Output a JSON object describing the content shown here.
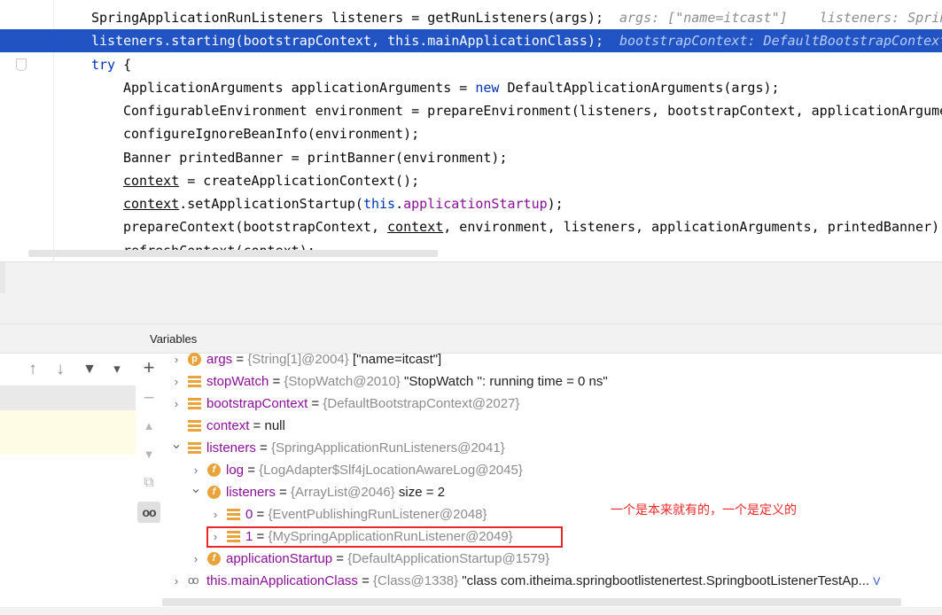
{
  "editor": {
    "lines": [
      {
        "id": "l1",
        "segments": [
          {
            "t": "SpringApplicationRunListeners listeners = getRunListeners(args);"
          }
        ],
        "hint": "args: [\"name=itcast\"]    listeners: Sprin"
      },
      {
        "id": "l2",
        "segments": [
          {
            "t": "listeners.starting(bootstrapContext, this.mainApplicationClass);"
          }
        ],
        "hint": "bootstrapContext: DefaultBootstrapContext@"
      },
      {
        "id": "l3",
        "segments": [
          {
            "t": "try",
            "cls": "kw"
          },
          {
            "t": " {"
          }
        ]
      },
      {
        "id": "l4",
        "segments": [
          {
            "t": "ApplicationArguments applicationArguments = "
          },
          {
            "t": "new",
            "cls": "kw"
          },
          {
            "t": " DefaultApplicationArguments(args);"
          }
        ]
      },
      {
        "id": "l5",
        "segments": [
          {
            "t": "ConfigurableEnvironment environment = prepareEnvironment(listeners, bootstrapContext, applicationArgume"
          }
        ]
      },
      {
        "id": "l6",
        "segments": [
          {
            "t": "configureIgnoreBeanInfo(environment);"
          }
        ]
      },
      {
        "id": "l7",
        "segments": [
          {
            "t": "Banner printedBanner = printBanner(environment);"
          }
        ]
      },
      {
        "id": "l8",
        "segments": [
          {
            "t": "context",
            "cls": "ul"
          },
          {
            "t": " = createApplicationContext();"
          }
        ]
      },
      {
        "id": "l9",
        "segments": [
          {
            "t": "context",
            "cls": "ul"
          },
          {
            "t": ".setApplicationStartup("
          },
          {
            "t": "this",
            "cls": "kw"
          },
          {
            "t": "."
          },
          {
            "t": "applicationStartup",
            "cls": "fld"
          },
          {
            "t": ");"
          }
        ]
      },
      {
        "id": "l10",
        "segments": [
          {
            "t": "prepareContext(bootstrapContext, "
          },
          {
            "t": "context",
            "cls": "ul"
          },
          {
            "t": ", environment, listeners, applicationArguments, printedBanner);"
          }
        ]
      },
      {
        "id": "l11",
        "segments": [
          {
            "t": "refreshContext("
          },
          {
            "t": "context",
            "cls": "ul"
          },
          {
            "t": ");"
          }
        ]
      }
    ]
  },
  "variables": {
    "title": "Variables",
    "rows": [
      {
        "id": "v1",
        "chev": "›",
        "icon": "p",
        "name": "args",
        "ref": "{String[1]@2004}",
        "value": " [\"name=itcast\"]"
      },
      {
        "id": "v2",
        "chev": "›",
        "icon": "list",
        "name": "stopWatch",
        "ref": "{StopWatch@2010}",
        "value": " \"StopWatch '': running time = 0 ns\""
      },
      {
        "id": "v3",
        "chev": "›",
        "icon": "list",
        "name": "bootstrapContext",
        "ref": "{DefaultBootstrapContext@2027}",
        "value": ""
      },
      {
        "id": "v4",
        "chev": "",
        "icon": "list",
        "name": "context",
        "ref": "",
        "value": "null"
      },
      {
        "id": "v5",
        "chev": "⌄",
        "icon": "list",
        "name": "listeners",
        "ref": "{SpringApplicationRunListeners@2041}",
        "value": ""
      },
      {
        "id": "v6",
        "chev": "›",
        "icon": "f",
        "name": "log",
        "ref": "{LogAdapter$Slf4jLocationAwareLog@2045}",
        "value": ""
      },
      {
        "id": "v7",
        "chev": "⌄",
        "icon": "f",
        "name": "listeners",
        "ref": "{ArrayList@2046}",
        "value": "  size = 2"
      },
      {
        "id": "v8",
        "chev": "›",
        "icon": "list",
        "name": "0",
        "ref": "{EventPublishingRunListener@2048}",
        "value": ""
      },
      {
        "id": "v9",
        "chev": "›",
        "icon": "list",
        "name": "1",
        "ref": "{MySpringApplicationRunListener@2049}",
        "value": ""
      },
      {
        "id": "v10",
        "chev": "›",
        "icon": "f",
        "name": "applicationStartup",
        "ref": "{DefaultApplicationStartup@1579}",
        "value": ""
      },
      {
        "id": "v11",
        "chev": "›",
        "icon": "oo",
        "name": "this.mainApplicationClass",
        "ref": "{Class@1338}",
        "value": " \"class com.itheima.springbootlistenertest.SpringbootListenerTestAp... "
      }
    ],
    "truncation_link": "V",
    "annotation": "一个是本来就有的，一个是定义的"
  },
  "frames_toolbar": {
    "up_icon": "↑",
    "down_icon": "↓",
    "filter_icon": "▼",
    "menu_icon": "▾"
  },
  "side_toolbar": {
    "add_icon": "+",
    "remove_icon": "−",
    "up_icon": "▲",
    "down_icon": "▼",
    "copy_icon": "⧉",
    "watch_icon": "oo"
  },
  "colors": {
    "highlight_line": "#2154c2",
    "keyword": "#0033b3",
    "field": "#871094",
    "annotation_red": "#e8262c"
  }
}
